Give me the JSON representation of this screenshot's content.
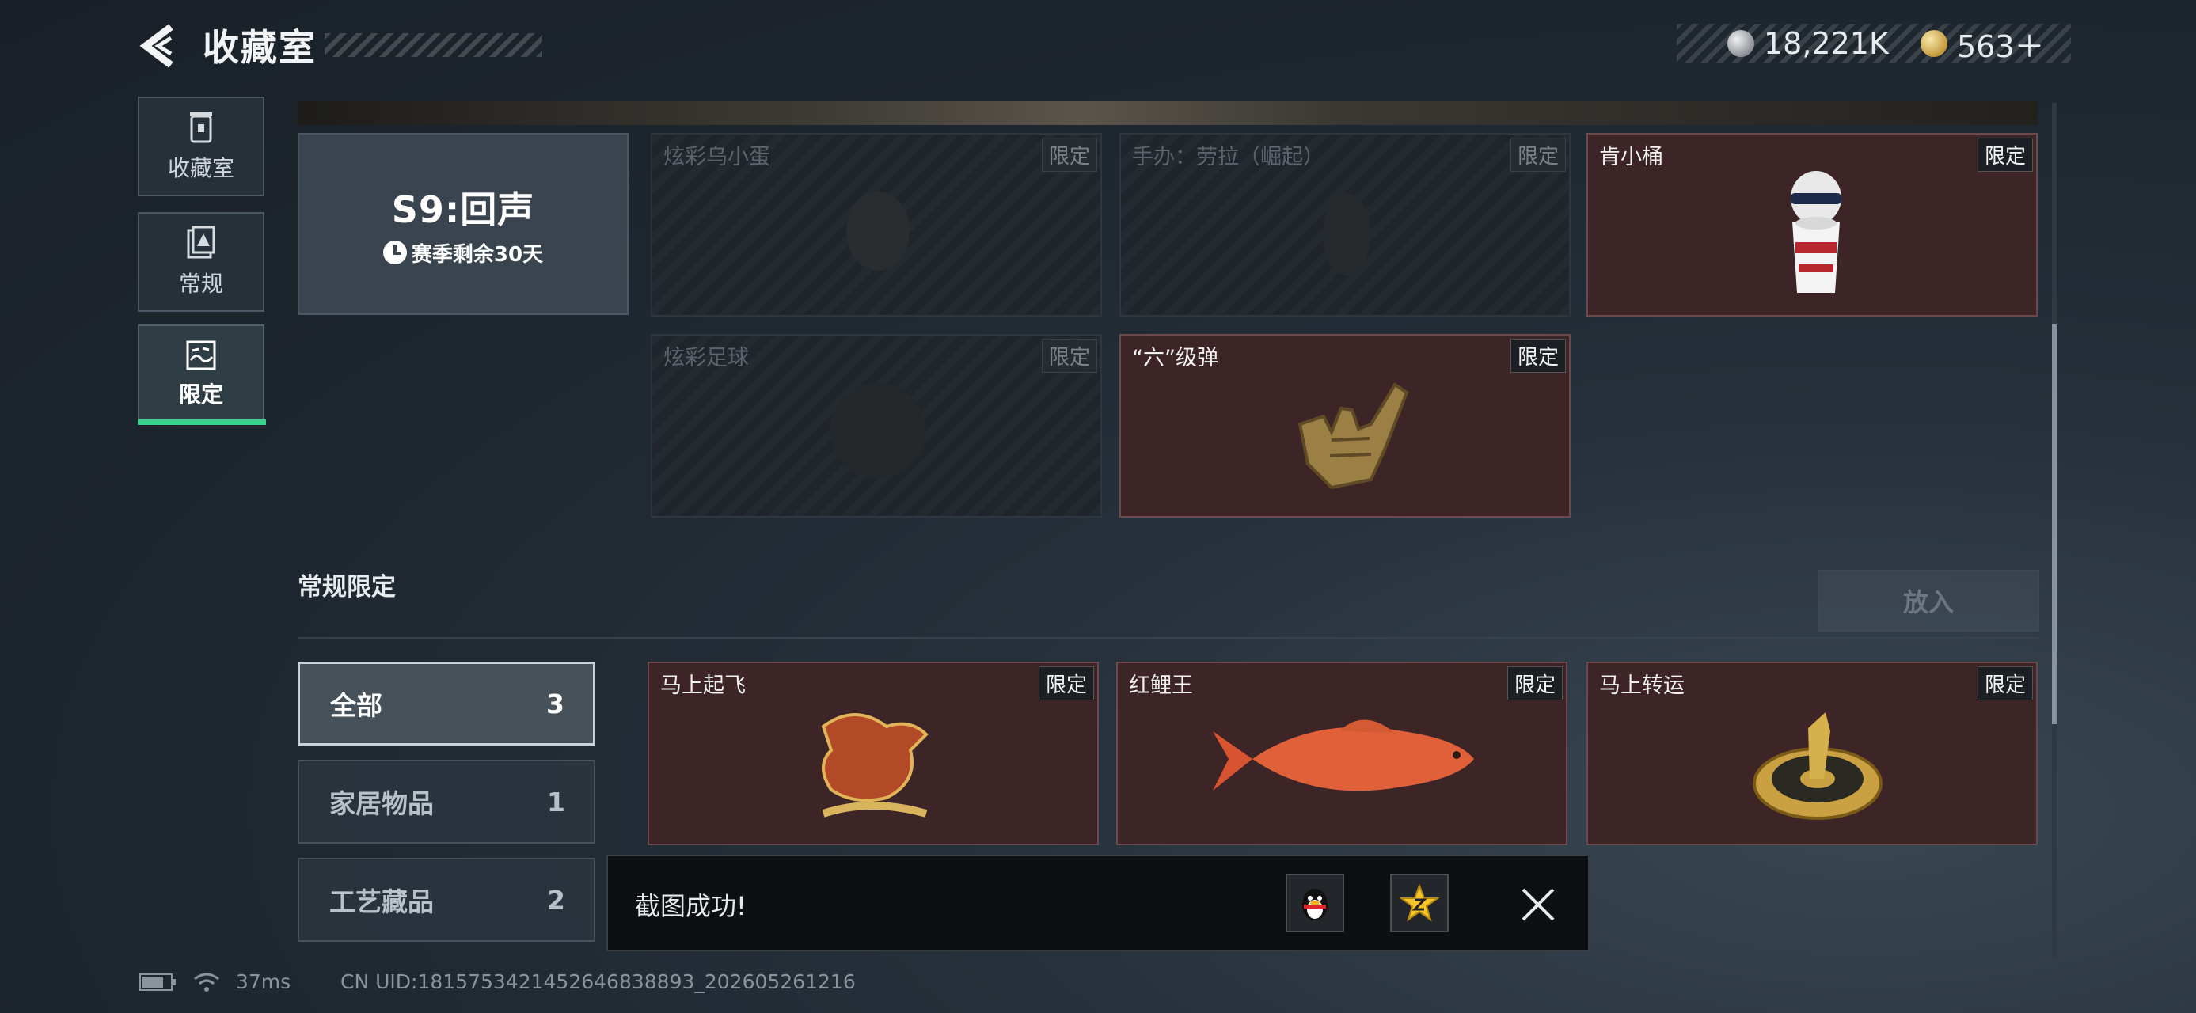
{
  "header": {
    "title": "收藏室",
    "currency": [
      {
        "icon": "silver-coin-icon",
        "value": "18,221K"
      },
      {
        "icon": "gold-coin-icon",
        "value": "563＋"
      }
    ]
  },
  "sidebar": {
    "items": [
      {
        "label": "收藏室",
        "icon": "trash-bin-icon",
        "active": false
      },
      {
        "label": "常规",
        "icon": "document-icon",
        "active": false
      },
      {
        "label": "限定",
        "icon": "wave-picture-icon",
        "active": true
      }
    ]
  },
  "season": {
    "title": "S9:回声",
    "remaining": "赛季剩余30天"
  },
  "season_items": [
    {
      "name": "炫彩乌小蛋",
      "tag": "限定",
      "owned": false
    },
    {
      "name": "手办：劳拉（崛起）",
      "tag": "限定",
      "owned": false
    },
    {
      "name": "肯小桶",
      "tag": "限定",
      "owned": true
    },
    {
      "name": "炫彩足球",
      "tag": "限定",
      "owned": false
    },
    {
      "name": "“六”级弹",
      "tag": "限定",
      "owned": true
    }
  ],
  "section": {
    "title": "常规限定",
    "put_button": "放入"
  },
  "filters": [
    {
      "label": "全部",
      "count": "3",
      "active": true
    },
    {
      "label": "家居物品",
      "count": "1",
      "active": false
    },
    {
      "label": "工艺藏品",
      "count": "2",
      "active": false
    }
  ],
  "regular_items": [
    {
      "name": "马上起飞",
      "tag": "限定"
    },
    {
      "name": "红鲤王",
      "tag": "限定"
    },
    {
      "name": "马上转运",
      "tag": "限定"
    }
  ],
  "toast": {
    "message": "截图成功!",
    "share_icons": [
      "qq-penguin-icon",
      "qzone-star-icon"
    ]
  },
  "status": {
    "ping": "37ms",
    "uid": "CN UID:1815753421452646838893_202605261216"
  },
  "colors": {
    "accent_green": "#3fcf8c",
    "owned_card": "#3d2427",
    "background": "#1d252d"
  }
}
